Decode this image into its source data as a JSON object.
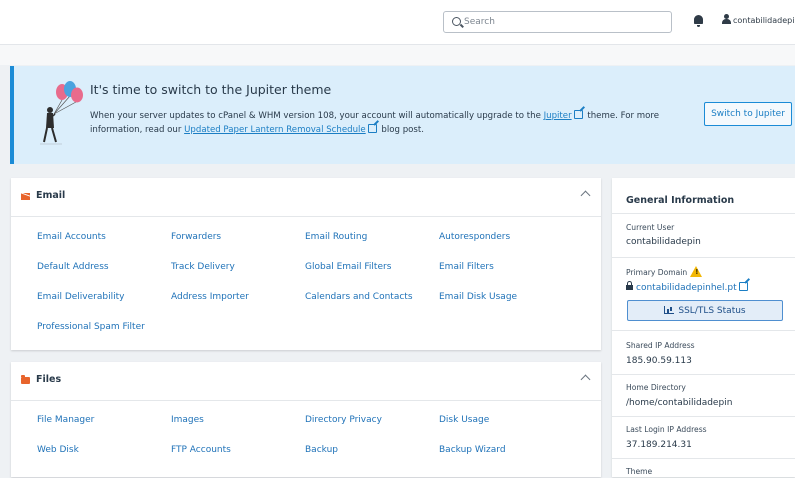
{
  "header": {
    "search_placeholder": "Search",
    "user_label": "contabilidadepin"
  },
  "banner": {
    "title": "It's time to switch to the Jupiter theme",
    "text_1": "When your server updates to cPanel & WHM version 108, your account will automatically upgrade to the ",
    "link_jupiter": "Jupiter",
    "text_2": " theme. For more information, read our ",
    "link_schedule": "Updated Paper Lantern Removal Schedule",
    "text_3": " blog post.",
    "button": "Switch to Jupiter"
  },
  "email": {
    "title": "Email",
    "links": [
      "Email Accounts",
      "Forwarders",
      "Email Routing",
      "Autoresponders",
      "Default Address",
      "Track Delivery",
      "Global Email Filters",
      "Email Filters",
      "Email Deliverability",
      "Address Importer",
      "Calendars and Contacts",
      "Email Disk Usage",
      "Professional Spam Filter"
    ]
  },
  "files": {
    "title": "Files",
    "links": [
      "File Manager",
      "Images",
      "Directory Privacy",
      "Disk Usage",
      "Web Disk",
      "FTP Accounts",
      "Backup",
      "Backup Wizard"
    ]
  },
  "general": {
    "title": "General Information",
    "current_user_label": "Current User",
    "current_user": "contabilidadepin",
    "primary_domain_label": "Primary Domain",
    "primary_domain": "contabilidadepinhel.pt",
    "ssl_button": "SSL/TLS Status",
    "shared_ip_label": "Shared IP Address",
    "shared_ip": "185.90.59.113",
    "home_dir_label": "Home Directory",
    "home_dir": "/home/contabilidadepin",
    "last_login_label": "Last Login IP Address",
    "last_login": "37.189.214.31",
    "theme_label": "Theme"
  },
  "colors": {
    "accent": "#1b8bd6",
    "link": "#1f72b8",
    "section_icon": "#e8642c",
    "warning": "#f2b705"
  }
}
